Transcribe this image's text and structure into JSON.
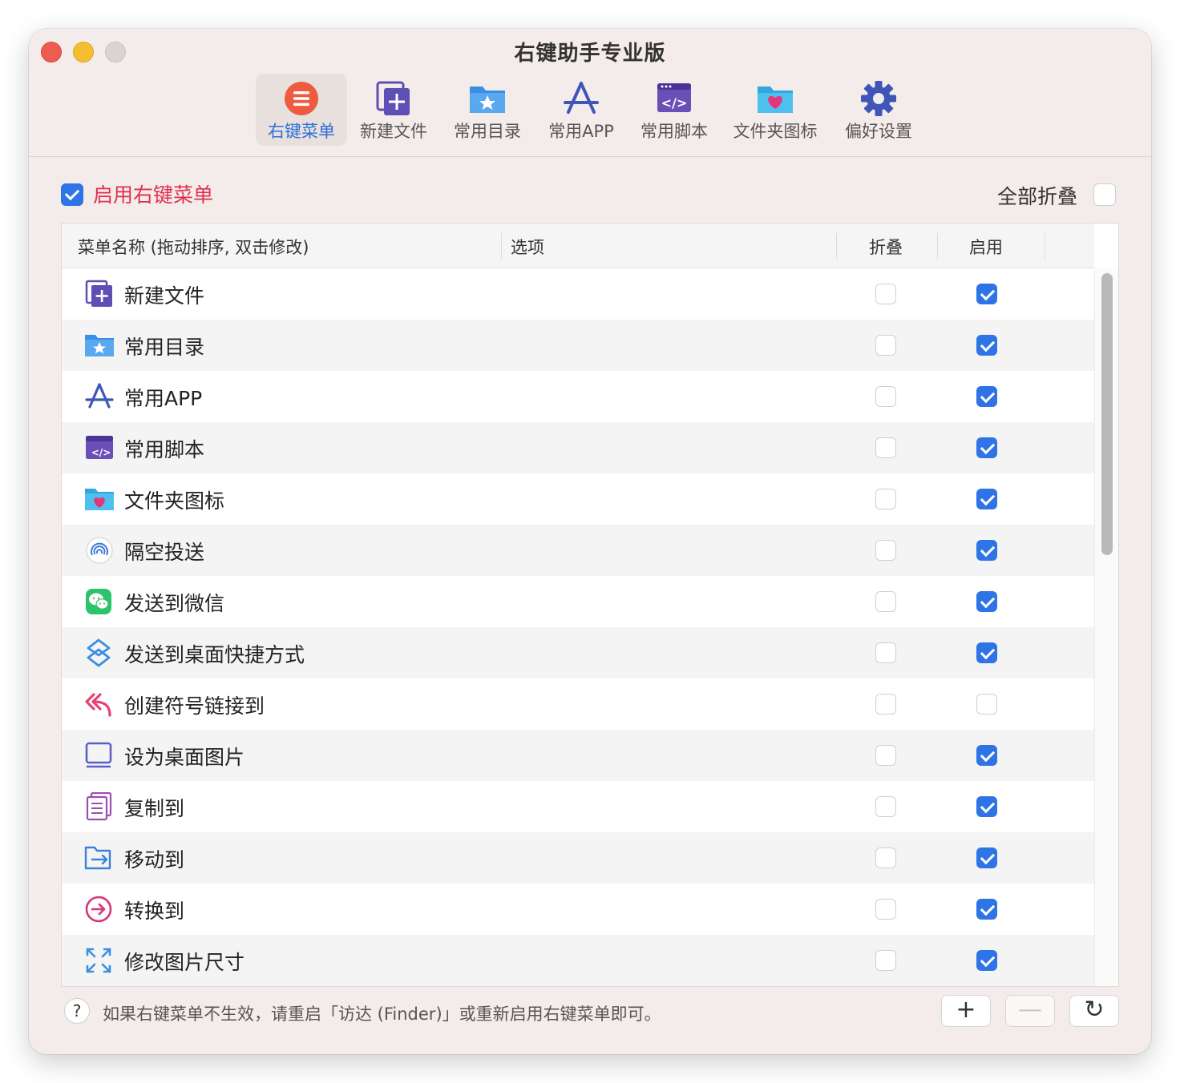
{
  "window": {
    "title": "右键助手专业版"
  },
  "toolbar": {
    "tabs": [
      {
        "label": "右键菜单",
        "icon": "list-circle-icon",
        "active": true
      },
      {
        "label": "新建文件",
        "icon": "new-file-icon",
        "active": false
      },
      {
        "label": "常用目录",
        "icon": "star-folder-icon",
        "active": false
      },
      {
        "label": "常用APP",
        "icon": "app-store-icon",
        "active": false
      },
      {
        "label": "常用脚本",
        "icon": "script-icon",
        "active": false
      },
      {
        "label": "文件夹图标",
        "icon": "heart-folder-icon",
        "active": false
      },
      {
        "label": "偏好设置",
        "icon": "gear-icon",
        "active": false
      }
    ]
  },
  "enable_menu": {
    "label": "启用右键菜单",
    "checked": true
  },
  "collapse_all": {
    "label": "全部折叠",
    "checked": false
  },
  "table": {
    "headers": {
      "name": "菜单名称 (拖动排序, 双击修改)",
      "options": "选项",
      "fold": "折叠",
      "enable": "启用"
    },
    "rows": [
      {
        "label": "新建文件",
        "icon": "new-file-icon",
        "fold": false,
        "enabled": true
      },
      {
        "label": "常用目录",
        "icon": "star-folder-icon",
        "fold": false,
        "enabled": true
      },
      {
        "label": "常用APP",
        "icon": "app-store-icon",
        "fold": false,
        "enabled": true
      },
      {
        "label": "常用脚本",
        "icon": "script-icon",
        "fold": false,
        "enabled": true
      },
      {
        "label": "文件夹图标",
        "icon": "heart-folder-icon",
        "fold": false,
        "enabled": true
      },
      {
        "label": "隔空投送",
        "icon": "airdrop-icon",
        "fold": false,
        "enabled": true
      },
      {
        "label": "发送到微信",
        "icon": "wechat-icon",
        "fold": false,
        "enabled": true
      },
      {
        "label": "发送到桌面快捷方式",
        "icon": "shortcut-icon",
        "fold": false,
        "enabled": true
      },
      {
        "label": "创建符号链接到",
        "icon": "symlink-arrow-icon",
        "fold": false,
        "enabled": false
      },
      {
        "label": "设为桌面图片",
        "icon": "desktop-picture-icon",
        "fold": false,
        "enabled": true
      },
      {
        "label": "复制到",
        "icon": "copy-documents-icon",
        "fold": false,
        "enabled": true
      },
      {
        "label": "移动到",
        "icon": "move-folder-icon",
        "fold": false,
        "enabled": true
      },
      {
        "label": "转换到",
        "icon": "convert-arrow-icon",
        "fold": false,
        "enabled": true
      },
      {
        "label": "修改图片尺寸",
        "icon": "resize-arrows-icon",
        "fold": false,
        "enabled": true
      }
    ]
  },
  "footer": {
    "help_glyph": "?",
    "note": "如果右键菜单不生效，请重启「访达 (Finder)」或重新启用右键菜单即可。",
    "add_glyph": "+",
    "remove_glyph": "—",
    "refresh_glyph": "↻"
  },
  "colors": {
    "accent": "#2f74e6",
    "enable_label": "#e0304f",
    "active_tab_label": "#2f6fd9"
  }
}
